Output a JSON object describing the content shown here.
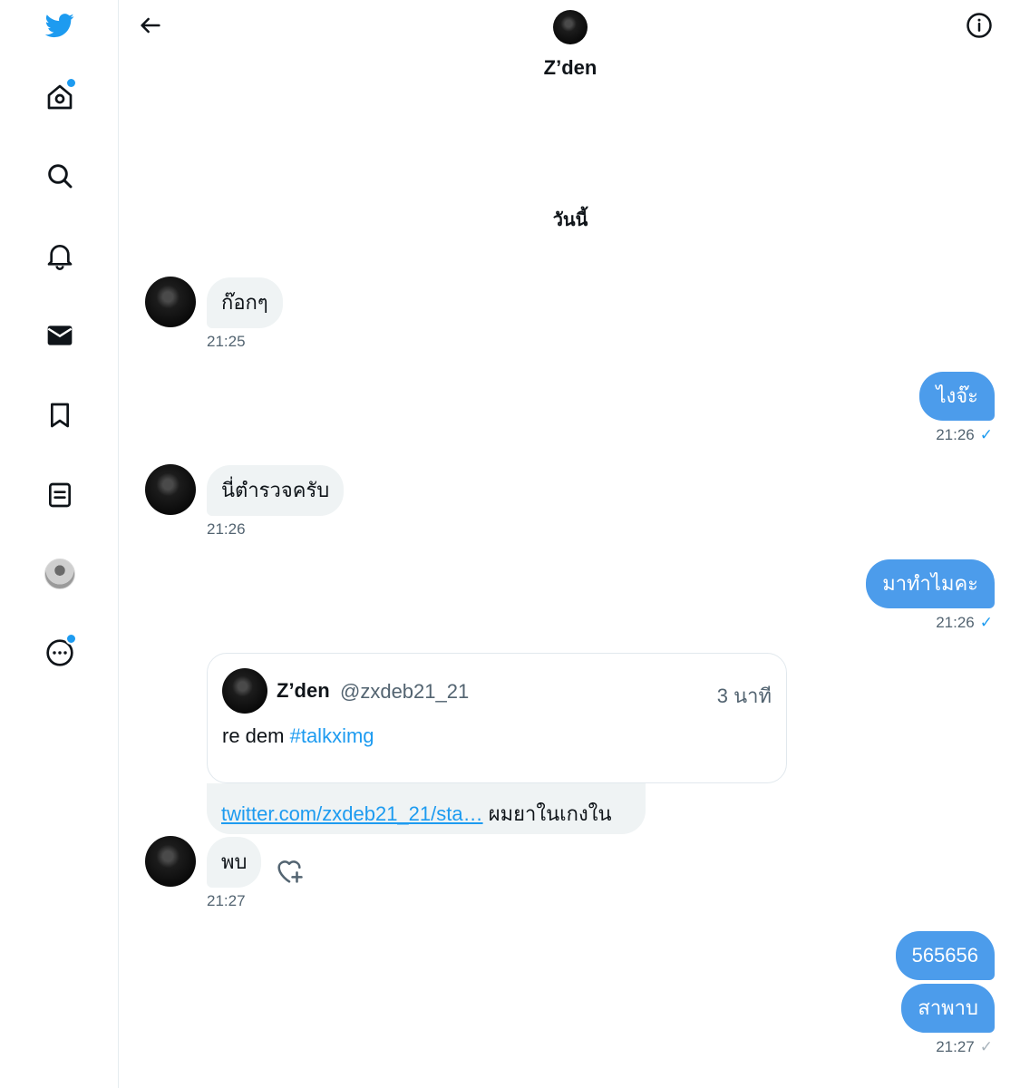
{
  "conversation": {
    "name": "Z’den",
    "day_label": "วันนี้"
  },
  "messages": [
    {
      "text": "ก๊อกๆ",
      "time": "21:25"
    },
    {
      "text": "ไงจ๊ะ",
      "time": "21:26",
      "status": "✓"
    },
    {
      "text": "นี่ตำรวจครับ",
      "time": "21:26"
    },
    {
      "text": "มาทำไมคะ",
      "time": "21:26",
      "status": "✓"
    },
    {
      "quote": {
        "name": "Z’den",
        "handle": "@zxdeb21_21",
        "age": "3 นาที",
        "text": "re dem ",
        "hashtag": "#talkximg"
      },
      "link_text": "twitter.com/zxdeb21_21/sta…",
      "text_after_link": " ผมยาในเกงใน"
    },
    {
      "text": "พบ",
      "time": "21:27"
    },
    {
      "text": "565656"
    },
    {
      "text": "สาพาบ",
      "time": "21:27",
      "status": "✓"
    }
  ],
  "colors": {
    "accent": "#1d9bf0",
    "outgoing_bubble": "#4c9ceb",
    "incoming_bubble": "#eff3f4"
  },
  "icons": [
    "twitter-logo-icon",
    "home-icon",
    "search-icon",
    "bell-icon",
    "mail-icon",
    "bookmark-icon",
    "lists-icon",
    "profile-avatar",
    "more-icon",
    "back-arrow-icon",
    "info-icon",
    "heart-add-icon"
  ]
}
